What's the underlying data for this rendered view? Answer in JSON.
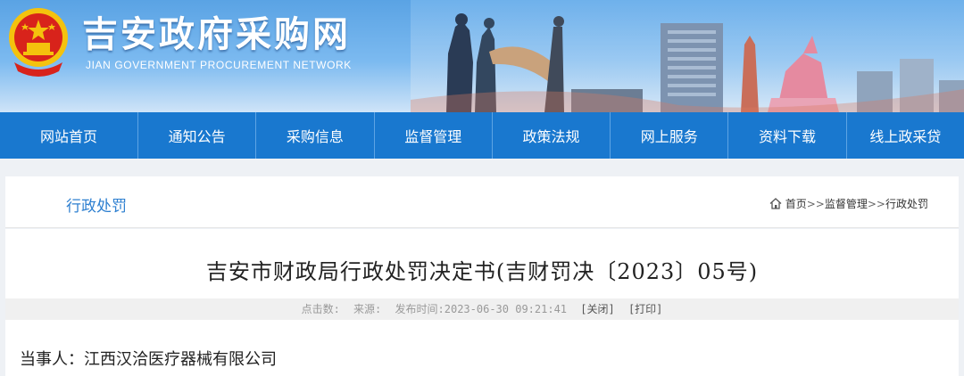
{
  "header": {
    "title": "吉安政府采购网",
    "subtitle": "JIAN GOVERNMENT PROCUREMENT NETWORK",
    "emblem_icon": "national-emblem-icon",
    "colors": {
      "banner_top": "#5aa3e4",
      "nav": "#1978cf"
    }
  },
  "nav": {
    "items": [
      {
        "label": "网站首页"
      },
      {
        "label": "通知公告"
      },
      {
        "label": "采购信息"
      },
      {
        "label": "监督管理"
      },
      {
        "label": "政策法规"
      },
      {
        "label": "网上服务"
      },
      {
        "label": "资料下载"
      },
      {
        "label": "线上政采贷"
      }
    ]
  },
  "section": {
    "title": "行政处罚"
  },
  "breadcrumb": {
    "home_icon": "home-icon",
    "home": "首页",
    "sep1": ">>",
    "level1": "监督管理",
    "sep2": ">>",
    "level2": "行政处罚"
  },
  "article": {
    "title": "吉安市财政局行政处罚决定书(吉财罚决〔2023〕05号)",
    "meta": {
      "clicks_label": "点击数:",
      "source_label": "来源:",
      "publish_label": "发布时间:",
      "publish_time": "2023-06-30 09:21:41",
      "close": "[关闭]",
      "print": "[打印]"
    },
    "party_line": "当事人：江西汉洽医疗器械有限公司"
  }
}
